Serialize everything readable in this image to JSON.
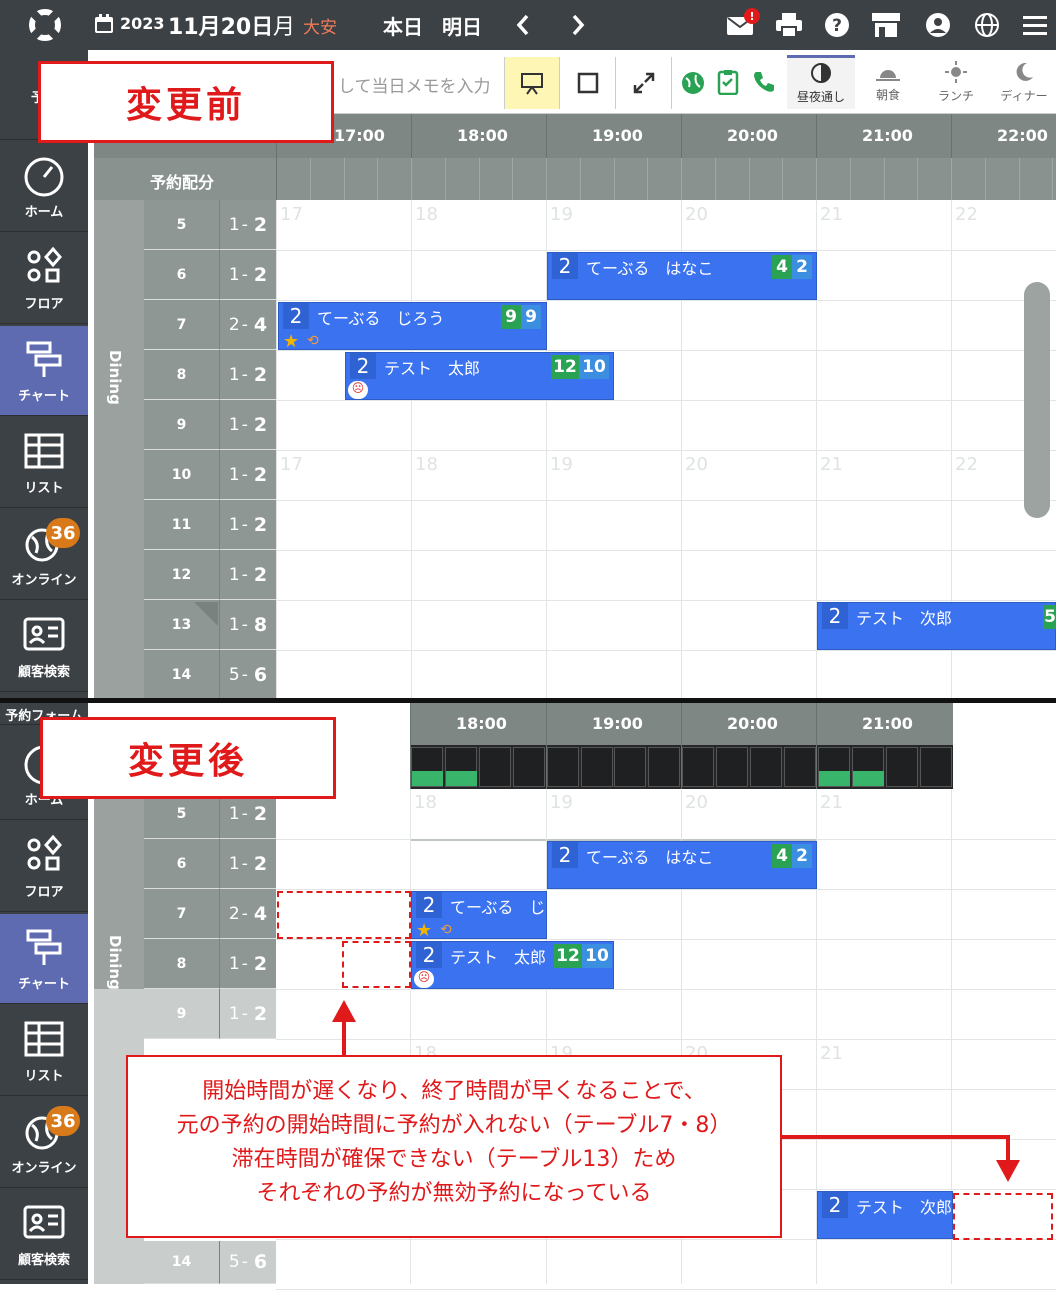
{
  "topbar": {
    "year": "2023",
    "date": "11月20日",
    "weekday": "月",
    "rokuyo": "大安",
    "today": "本日",
    "tomorrow": "明日",
    "mail_badge": "!"
  },
  "toolbar": {
    "memo_placeholder": "して当日メモを入力",
    "modes": [
      "昼夜通し",
      "朝食",
      "ランチ",
      "ディナー"
    ]
  },
  "sidebar": {
    "items": [
      "予約",
      "ホーム",
      "フロア",
      "チャート",
      "リスト",
      "オンライン",
      "顧客検索"
    ],
    "online_badge": "36",
    "partial_top_label": "予約フォーム"
  },
  "before": {
    "label": "変更前",
    "hours": [
      "17:00",
      "18:00",
      "19:00",
      "20:00",
      "21:00",
      "22:00"
    ],
    "allocation_label": "予約配分",
    "area": "Dining",
    "ghost_hours": [
      "17",
      "18",
      "19",
      "20",
      "21",
      "22"
    ]
  },
  "after": {
    "label": "変更後",
    "hours": [
      "18:00",
      "19:00",
      "20:00",
      "21:00"
    ],
    "ghost_hours": [
      "18",
      "19",
      "20",
      "21"
    ]
  },
  "tables": [
    {
      "no": "5",
      "min": "1",
      "max": "2"
    },
    {
      "no": "6",
      "min": "1",
      "max": "2"
    },
    {
      "no": "7",
      "min": "2",
      "max": "4"
    },
    {
      "no": "8",
      "min": "1",
      "max": "2"
    },
    {
      "no": "9",
      "min": "1",
      "max": "2"
    },
    {
      "no": "10",
      "min": "1",
      "max": "2"
    },
    {
      "no": "11",
      "min": "1",
      "max": "2"
    },
    {
      "no": "12",
      "min": "1",
      "max": "2"
    },
    {
      "no": "13",
      "min": "1",
      "max": "8"
    },
    {
      "no": "14",
      "min": "5",
      "max": "6"
    }
  ],
  "reservations": {
    "hanako": {
      "count": "2",
      "name": "てーぶる　はなこ",
      "b1": "4",
      "b2": "2"
    },
    "jirou": {
      "count": "2",
      "name": "てーぶる　じろう",
      "name_cut": "てーぶる　じろ",
      "b1": "9",
      "b2": "9"
    },
    "taro": {
      "count": "2",
      "name": "テスト　太郎",
      "b1": "12",
      "b2": "10"
    },
    "jiro_test": {
      "count": "2",
      "name": "テスト　次郎",
      "b1": "5"
    }
  },
  "annotation": {
    "line1": "開始時間が遅くなり、終了時間が早くなることで、",
    "line2": "元の予約の開始時間に予約が入れない（テーブル7・8）",
    "line3": "滞在時間が確保できない（テーブル13）ため",
    "line4": "それぞれの予約が無効予約になっている"
  },
  "colors": {
    "reservation": "#3a72f0",
    "sidebar": "#3c4145",
    "header": "#7e8784",
    "annotation": "#e0191b"
  }
}
